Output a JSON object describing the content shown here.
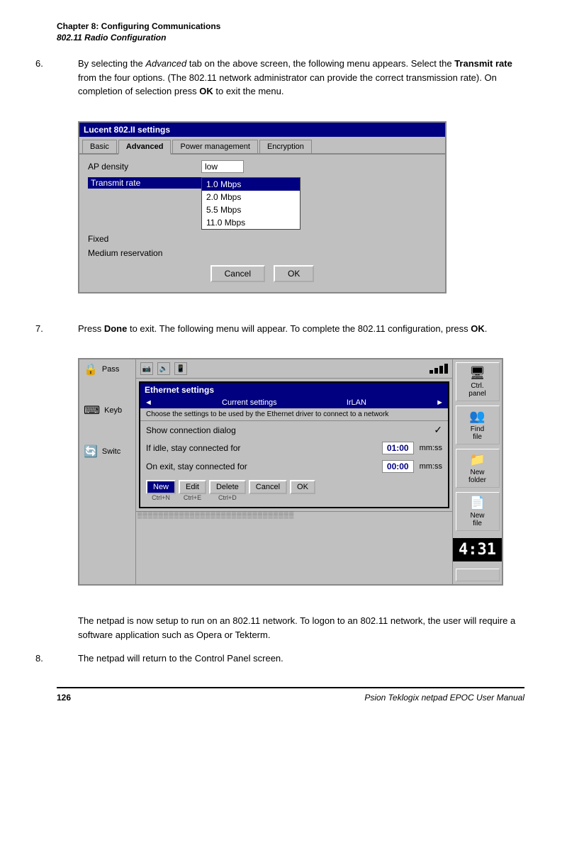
{
  "header": {
    "chapter": "Chapter 8:  Configuring Communications",
    "subheader": "802.11 Radio Configuration"
  },
  "step6": {
    "number": "6.",
    "text1": "By selecting the ",
    "italic": "Advanced",
    "text2": " tab on the above screen, the following menu appears. Select the ",
    "bold": "Transmit rate",
    "text3": " from the four options. (The 802.11 network administrator can provide the correct transmission rate). On completion of selection press ",
    "bold2": "OK",
    "text4": " to exit the menu."
  },
  "lucent": {
    "title": "Lucent 802.II settings",
    "tabs": [
      "Basic",
      "Advanced",
      "Power management",
      "Encryption"
    ],
    "active_tab": "Advanced",
    "rows": [
      {
        "label": "AP density",
        "value": "low"
      },
      {
        "label": "Transmit rate",
        "value": "",
        "highlight": true
      },
      {
        "label": "Fixed",
        "value": ""
      },
      {
        "label": "Medium reservation",
        "value": ""
      }
    ],
    "dropdown_items": [
      "1.0 Mbps",
      "2.0 Mbps",
      "5.5 Mbps",
      "11.0 Mbps"
    ],
    "dropdown_selected": "1.0 Mbps",
    "cancel_btn": "Cancel",
    "ok_btn": "OK"
  },
  "step7": {
    "number": "7.",
    "text1": "Press ",
    "bold": "Done",
    "text2": " to exit. The following menu will appear. To complete the 802.11 configuration, press ",
    "bold2": "OK",
    "text3": "."
  },
  "ethernet": {
    "dialog_title": "Ethernet settings",
    "dialog_subtitle": "Current settings",
    "network_name": "IrLAN",
    "description": "Choose the settings to be used by the Ethernet driver to connect to a network",
    "rows": [
      {
        "label": "Show connection dialog",
        "type": "check",
        "value": "✓"
      },
      {
        "label": "If idle, stay connected for",
        "type": "time",
        "value": "01:00",
        "unit": "mm:ss"
      },
      {
        "label": "On exit, stay connected for",
        "type": "time",
        "value": "00:00",
        "unit": "mm:ss"
      }
    ],
    "buttons": [
      {
        "label": "New",
        "shortcut": "Ctrl+N"
      },
      {
        "label": "Edit",
        "shortcut": "Ctrl+E"
      },
      {
        "label": "Delete",
        "shortcut": "Ctrl+D"
      },
      {
        "label": "Cancel",
        "shortcut": ""
      },
      {
        "label": "OK",
        "shortcut": ""
      }
    ],
    "left_panel": {
      "items": [
        "Pass",
        "Keyb",
        "Switc"
      ]
    },
    "sidebar_items": [
      {
        "icon": "🖥",
        "label": "Ctrl.\npanel"
      },
      {
        "icon": "👥",
        "label": "Find\nfile"
      },
      {
        "icon": "📁",
        "label": "New\nfolder"
      },
      {
        "icon": "📄",
        "label": "New\nfile"
      }
    ],
    "time": "4:31"
  },
  "paragraph": {
    "text": "The netpad is now setup to run on an 802.11 network. To logon to an 802.11 network, the user will require a software application such as Opera or Tekterm."
  },
  "step8": {
    "number": "8.",
    "text": "The netpad will return to the Control Panel screen."
  },
  "footer": {
    "left": "126",
    "right": "Psion Teklogix netpad EPOC User Manual"
  }
}
